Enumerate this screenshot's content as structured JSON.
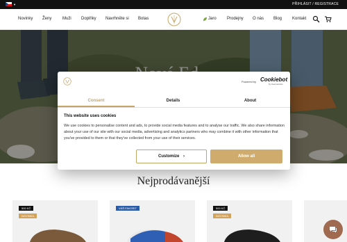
{
  "topbar": {
    "account": "PŘIHLÁSIT / REGISTRACE"
  },
  "nav": {
    "left": [
      "Novinky",
      "Ženy",
      "Muži",
      "Doplňky",
      "Navrhněte si",
      "Botas"
    ],
    "right": [
      "Jaro",
      "Prodejny",
      "O nás",
      "Blog",
      "Kontakt"
    ]
  },
  "hero": {
    "title": "Nové Ed..."
  },
  "section": {
    "title": "Nejprodávanější"
  },
  "cards": [
    {
      "badge1": "500 KČ",
      "badge2": "NOVINKA"
    },
    {
      "badge1": "VÁŠ FAVORIT"
    },
    {
      "badge1": "500 KČ",
      "badge2": "NOVINKA"
    },
    {}
  ],
  "cookie": {
    "powered_by": "Powered by",
    "brand": "Cookiebot",
    "brand_sub": "by Usercentrics",
    "tabs": [
      "Consent",
      "Details",
      "About"
    ],
    "heading": "This website uses cookies",
    "body": "We use cookies to personalise content and ads, to provide social media features and to analyse our traffic. We also share information about your use of our site with our social media, advertising and analytics partners who may combine it with other information that you've provided to them or that they've collected from your use of their services.",
    "customize": "Customize",
    "allow_all": "Allow all"
  },
  "colors": {
    "accent": "#c8a464",
    "dark": "#111111"
  }
}
